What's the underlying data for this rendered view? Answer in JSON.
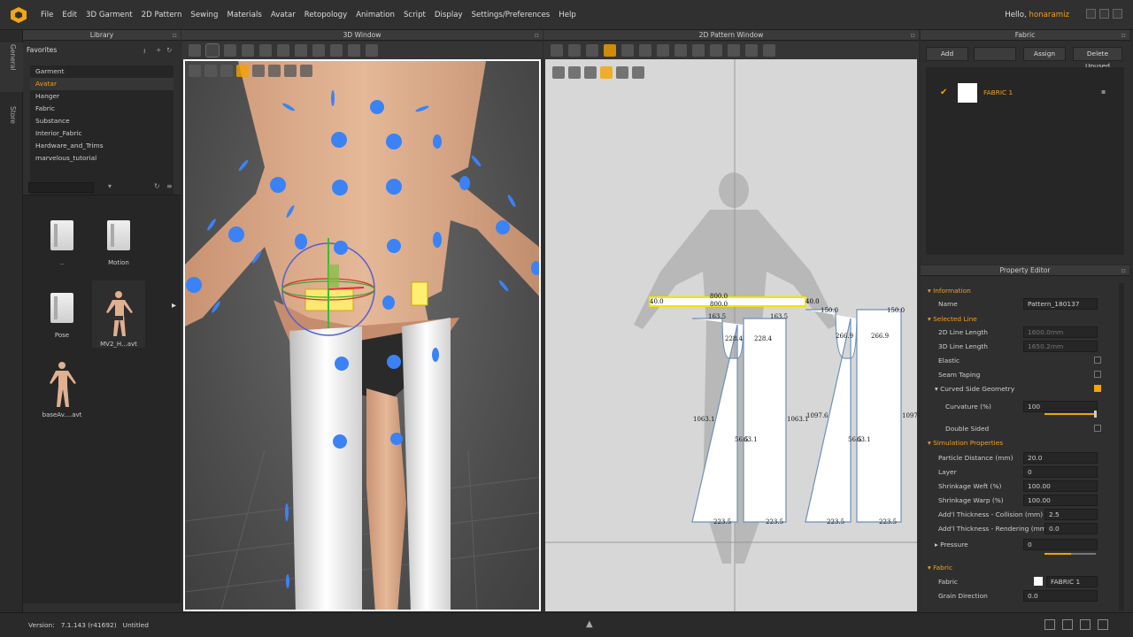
{
  "menubar": {
    "items": [
      "File",
      "Edit",
      "3D Garment",
      "2D Pattern",
      "Sewing",
      "Materials",
      "Avatar",
      "Retopology",
      "Animation",
      "Script",
      "Display",
      "Settings/Preferences",
      "Help"
    ],
    "greeting": "Hello,",
    "user": "honaramiz"
  },
  "sidestrip": {
    "tabs": [
      "General",
      "Store"
    ]
  },
  "library": {
    "title": "Library",
    "favorites": "Favorites",
    "items": [
      "Garment",
      "Avatar",
      "Hanger",
      "Fabric",
      "Substance",
      "Interior_Fabric",
      "Hardware_and_Trims",
      "marvelous_tutorial"
    ],
    "selected": "Avatar",
    "files": [
      {
        "name": "..",
        "type": "folder"
      },
      {
        "name": "Motion",
        "type": "folder"
      },
      {
        "name": "Pose",
        "type": "folder"
      },
      {
        "name": "MV2_H...avt",
        "type": "avatar"
      },
      {
        "name": "baseAv....avt",
        "type": "avatar"
      }
    ]
  },
  "win3d": {
    "title": "3D Window"
  },
  "win2d": {
    "title": "2D Pattern Window",
    "labels": {
      "seg_top": "800.0",
      "seg_bot": "800.0",
      "seg_l": "40.0",
      "seg_r": "40.0",
      "p1_tl": "163.5",
      "p1_tr": "163.5",
      "p1_cl": "228.4",
      "p1_cr": "228.4",
      "p1_left": "1063.1",
      "p1_mid_a": "56.5",
      "p1_mid_b": "63.1",
      "p1_right": "1063.1",
      "p1_bl": "223.5",
      "p1_br": "223.5",
      "p2_tl": "150.0",
      "p2_tr": "150.0",
      "p2_cl": "266.9",
      "p2_cr": "266.9",
      "p2_left": "1097.6",
      "p2_mid_a": "56.5",
      "p2_mid_b": "63.1",
      "p2_right": "1097.",
      "p2_bl": "223.5",
      "p2_br": "223.5"
    }
  },
  "fabric": {
    "title": "Fabric",
    "buttons": [
      "Add",
      "",
      "Assign",
      "Delete Unused"
    ],
    "items": [
      {
        "name": "FABRIC 1",
        "checked": true
      }
    ]
  },
  "property": {
    "title": "Property Editor",
    "sections": [
      {
        "title": "Information",
        "rows": [
          {
            "label": "Name",
            "value": "Pattern_180137"
          }
        ]
      },
      {
        "title": "Selected Line",
        "rows": [
          {
            "label": "2D Line Length",
            "value": "1600.0mm",
            "dim": true
          },
          {
            "label": "3D Line Length",
            "value": "1650.2mm",
            "dim": true
          },
          {
            "label": "Elastic",
            "check": false
          },
          {
            "label": "Seam Taping",
            "check": false
          },
          {
            "label": "Curved Side Geometry",
            "check": true
          },
          {
            "label": "Curvature (%)",
            "value": "100"
          },
          {
            "label": "Double Sided",
            "check": false
          }
        ]
      },
      {
        "title": "Simulation Properties",
        "rows": [
          {
            "label": "Particle Distance (mm)",
            "value": "20.0"
          },
          {
            "label": "Layer",
            "value": "0"
          },
          {
            "label": "Shrinkage Weft (%)",
            "value": "100.00"
          },
          {
            "label": "Shrinkage Warp (%)",
            "value": "100.00"
          },
          {
            "label": "Add'l Thickness - Collision (mm)",
            "value": "2.5"
          },
          {
            "label": "Add'l Thickness - Rendering (mm)",
            "value": "0.0"
          },
          {
            "label": "Pressure",
            "value": "0"
          }
        ]
      },
      {
        "title": "Fabric",
        "rows": [
          {
            "label": "Fabric",
            "value": "FABRIC 1"
          },
          {
            "label": "Grain Direction",
            "value": "0.0"
          }
        ]
      }
    ]
  },
  "status": {
    "version_label": "Version:",
    "version": "7.1.143 (r41692)",
    "file": "Untitled"
  },
  "colors": {
    "accent": "#f5a300",
    "pin": "#3b82f6",
    "pattern_outline": "#6f8fb8"
  }
}
